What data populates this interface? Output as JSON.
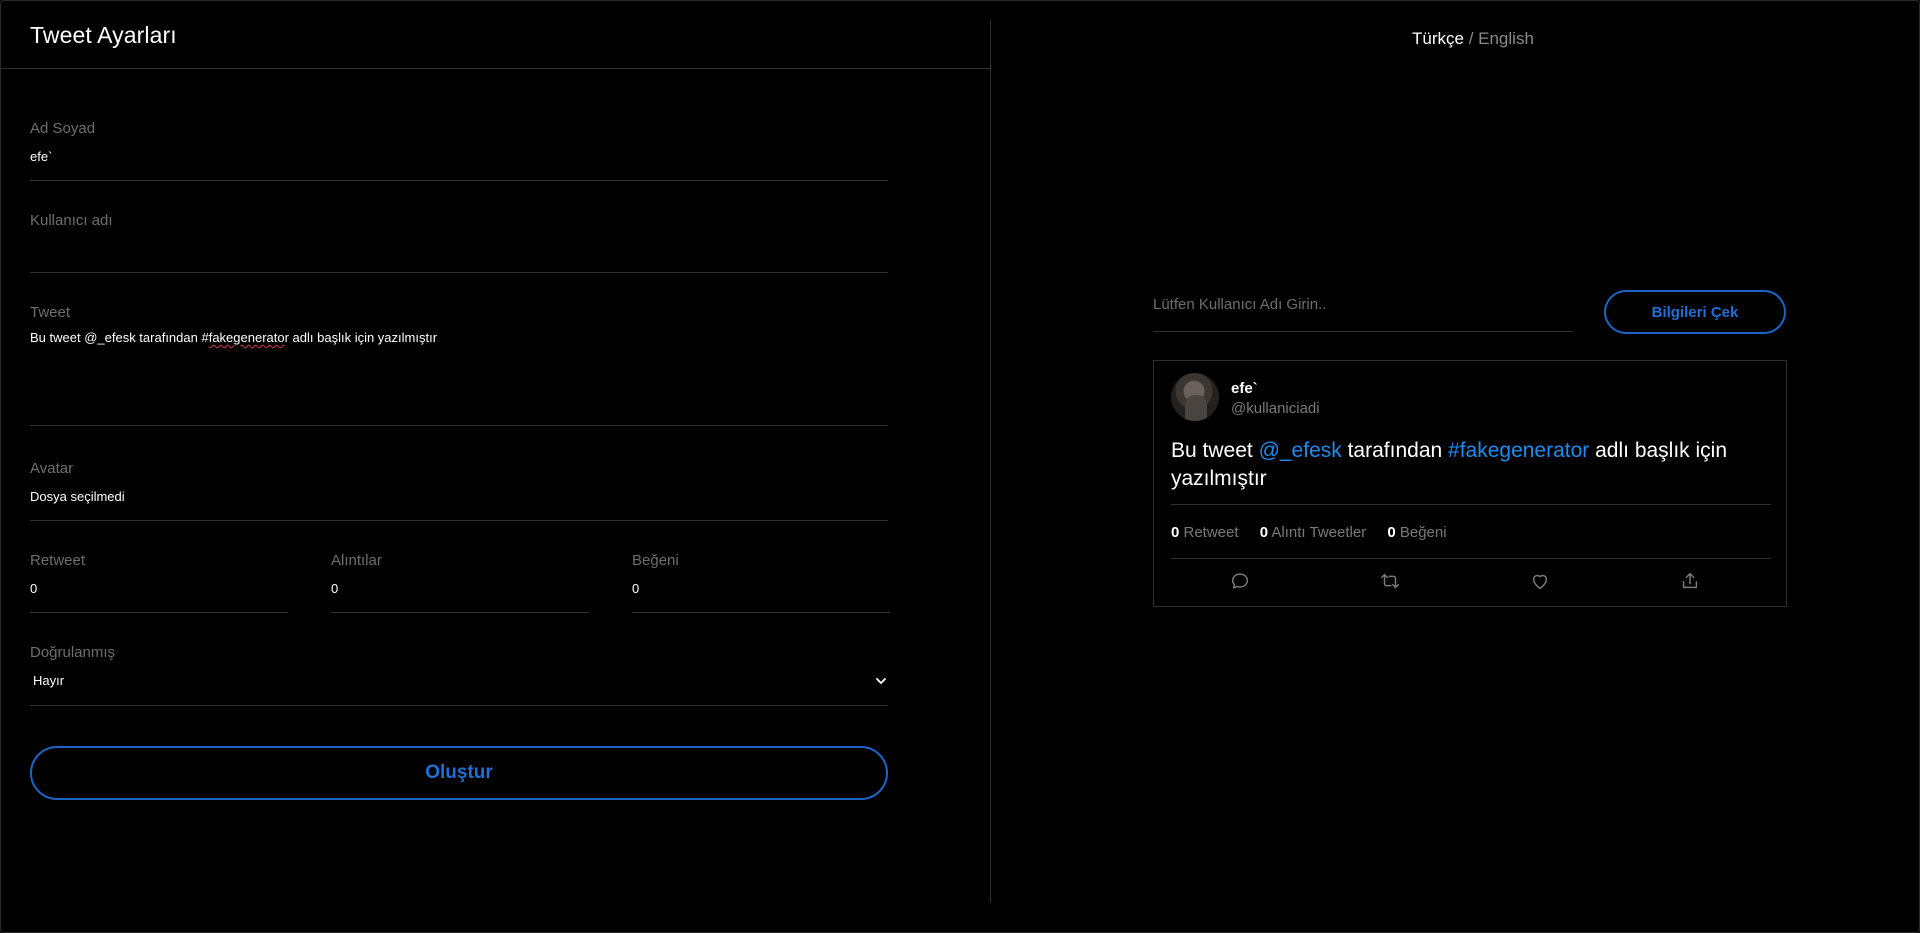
{
  "settings": {
    "title": "Tweet Ayarları",
    "name": {
      "label": "Ad Soyad",
      "value": "efe`"
    },
    "username": {
      "label": "Kullanıcı adı",
      "value": ""
    },
    "tweet": {
      "label": "Tweet",
      "before": "Bu tweet @_efesk tarafından #",
      "squiggle": "fakegenerato",
      "after": "r adlı başlık için yazılmıştır"
    },
    "avatar": {
      "label": "Avatar",
      "value": "Dosya seçilmedi"
    },
    "retweet": {
      "label": "Retweet",
      "value": "0"
    },
    "quotes": {
      "label": "Alıntılar",
      "value": "0"
    },
    "likes": {
      "label": "Beğeni",
      "value": "0"
    },
    "verified": {
      "label": "Doğrulanmış",
      "value": "Hayır"
    },
    "create_button": "Oluştur"
  },
  "language": {
    "current": "Türkçe",
    "separator": " / ",
    "other": "English"
  },
  "fetch": {
    "placeholder": "Lütfen Kullanıcı Adı Girin..",
    "button": "Bilgileri Çek"
  },
  "preview": {
    "display_name": "efe`",
    "handle": "@kullaniciadi",
    "text_parts": {
      "p1": "Bu tweet ",
      "mention": "@_efesk",
      "p2": " tarafından ",
      "hashtag": "#fakegenerator",
      "p3": " adlı başlık için yazılmıştır"
    },
    "stats": {
      "retweets_count": "0",
      "retweets_label": " Retweet",
      "quotes_count": "0",
      "quotes_label": " Alıntı Tweetler",
      "likes_count": "0",
      "likes_label": " Beğeni"
    },
    "icons": [
      "reply-icon",
      "retweet-icon",
      "like-icon",
      "share-icon"
    ]
  },
  "colors": {
    "accent": "#1d64c8",
    "link": "#1d8cf0",
    "background": "#000000",
    "muted": "#6e6e6e"
  }
}
